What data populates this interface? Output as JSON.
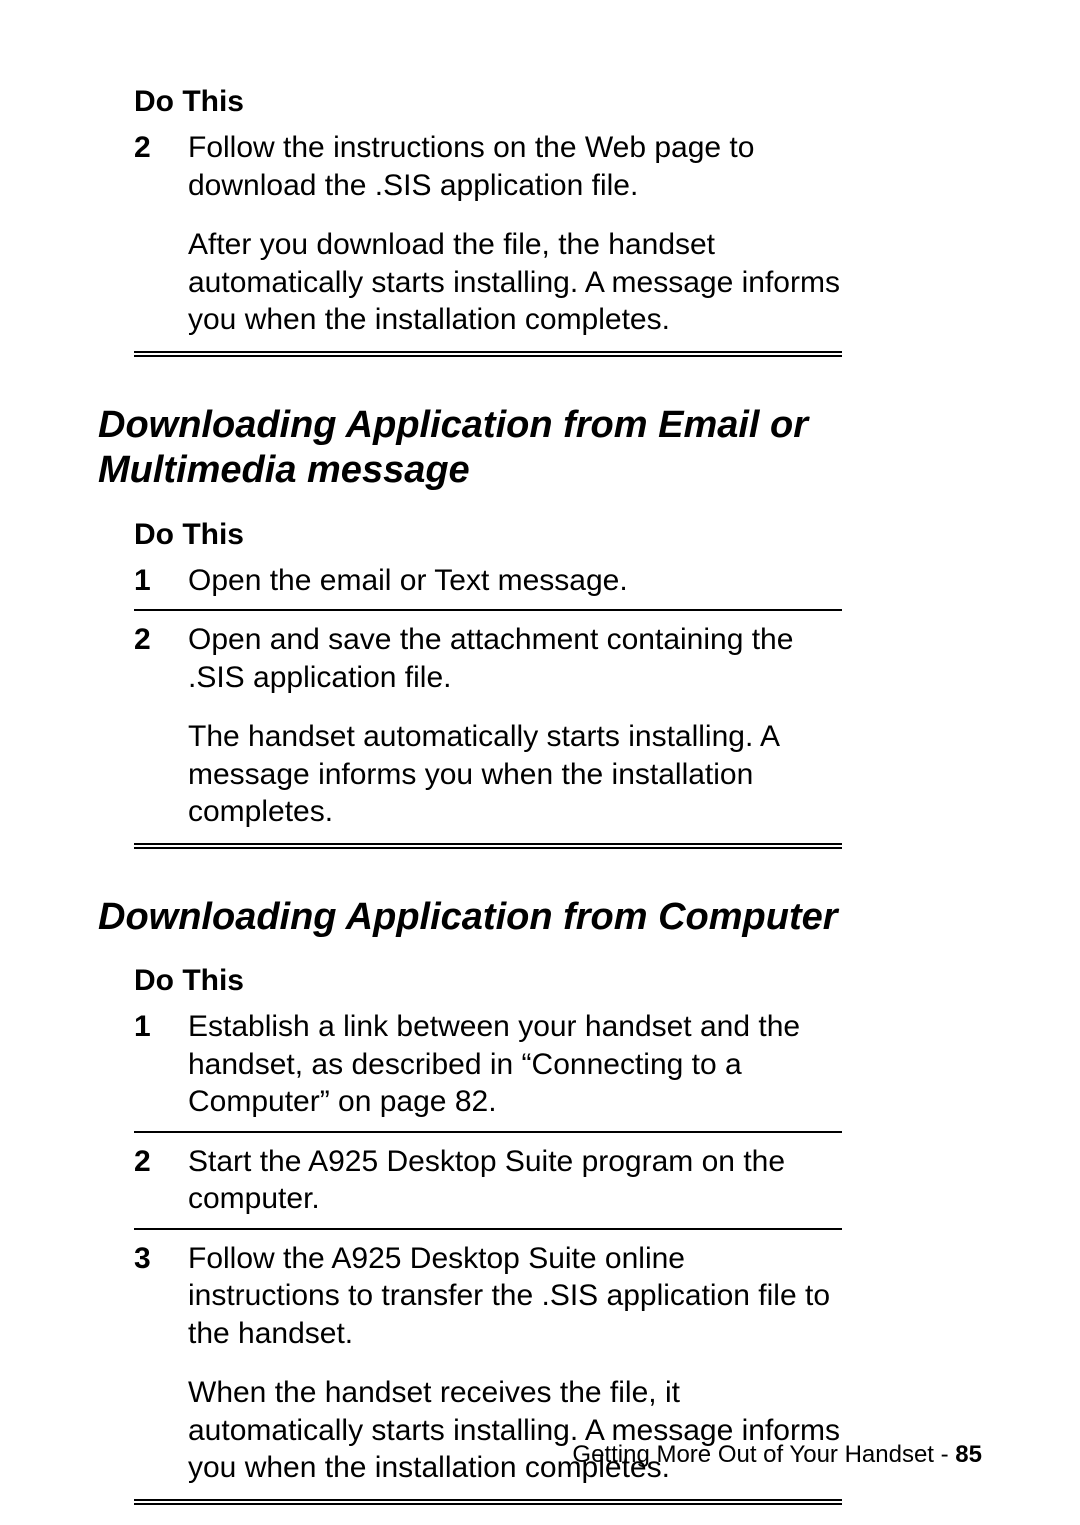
{
  "section1": {
    "header": "Do This",
    "steps": [
      {
        "num": "2",
        "paras": [
          "Follow the instructions on the Web page to download the .SIS application file.",
          "After you download the file, the handset automatically starts installing. A message informs you when the installation completes."
        ]
      }
    ]
  },
  "heading2": "Downloading Application from Email or Multimedia message",
  "section2": {
    "header": "Do This",
    "steps": [
      {
        "num": "1",
        "paras": [
          "Open the email or Text message."
        ]
      },
      {
        "num": "2",
        "paras": [
          "Open and save the attachment containing the .SIS application file.",
          "The handset automatically starts installing. A message informs you when the installation completes."
        ]
      }
    ]
  },
  "heading3": "Downloading Application from Computer",
  "section3": {
    "header": "Do This",
    "steps": [
      {
        "num": "1",
        "paras": [
          "Establish a link between your handset and the handset, as described in “Connecting to a Computer” on page 82."
        ]
      },
      {
        "num": "2",
        "paras": [
          "Start the A925 Desktop Suite program on the computer."
        ]
      },
      {
        "num": "3",
        "paras": [
          "Follow the A925 Desktop Suite online instructions to transfer the .SIS application file to the handset.",
          "When the handset receives the file, it automatically starts installing. A message informs you when the installation completes."
        ]
      }
    ]
  },
  "footer": {
    "text": "Getting More Out of Your Handset - ",
    "page": "85"
  }
}
